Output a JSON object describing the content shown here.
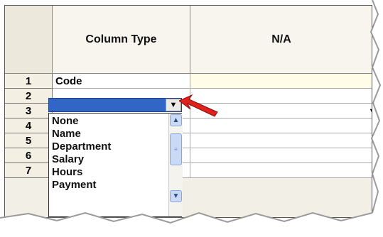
{
  "headers": {
    "column_type": "Column Type",
    "na": "N/A"
  },
  "rows": [
    {
      "num": "1",
      "value": "Code"
    },
    {
      "num": "2",
      "value": ""
    },
    {
      "num": "3",
      "value": ""
    },
    {
      "num": "4",
      "value": ""
    },
    {
      "num": "5",
      "value": ""
    },
    {
      "num": "6",
      "value": ""
    },
    {
      "num": "7",
      "value": ""
    }
  ],
  "dropdown": {
    "options": [
      "None",
      "Name",
      "Department",
      "Salary",
      "Hours",
      "Payment"
    ]
  },
  "colors": {
    "selected": "#3165c6",
    "arrow": "#e0201c"
  },
  "icons": {
    "combo": "chevron-down-icon",
    "scroll_up": "scroll-up-icon",
    "scroll_down": "scroll-down-icon",
    "pointer": "red-arrow-icon"
  }
}
